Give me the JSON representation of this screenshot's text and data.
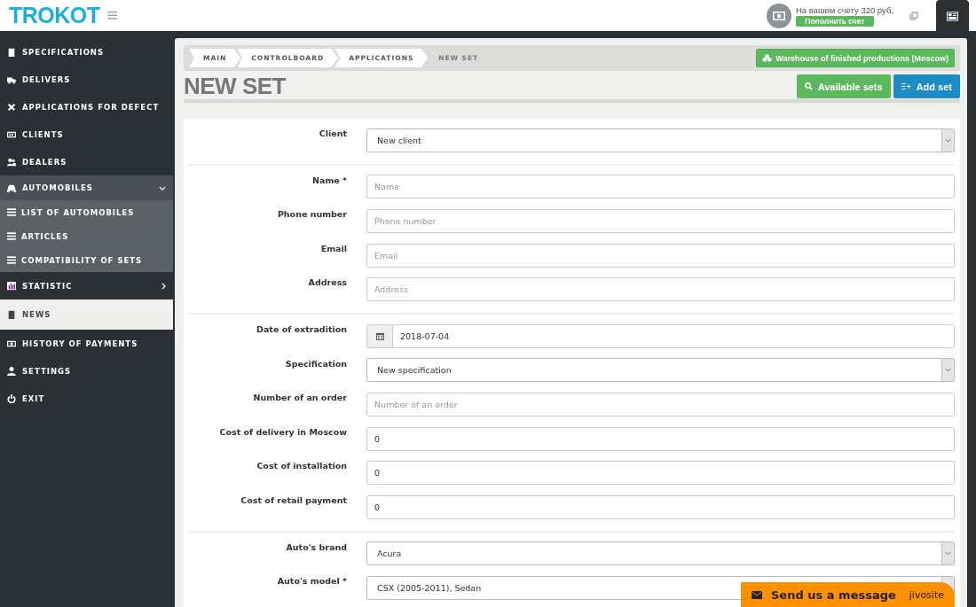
{
  "header": {
    "logo": "TROKOT",
    "balance": "На вашем счету 320 руб.",
    "topup_button": "Пополнить счет"
  },
  "sidebar": {
    "items": [
      {
        "label": "SPECIFICATIONS",
        "selected": false
      },
      {
        "label": "DELIVERS",
        "selected": false
      },
      {
        "label": "APPLICATIONS FOR DEFECT",
        "selected": false
      },
      {
        "label": "CLIENTS",
        "selected": false
      },
      {
        "label": "DEALERS",
        "selected": false
      },
      {
        "label": "AUTOMOBILES",
        "selected": false,
        "expanded": true,
        "children": [
          {
            "label": "LIST OF AUTOMOBILES"
          },
          {
            "label": "ARTICLES"
          },
          {
            "label": "COMPATIBILITY OF SETS"
          }
        ]
      },
      {
        "label": "STATISTIC",
        "selected": false,
        "expanded": false
      },
      {
        "label": "NEWS",
        "selected": true
      },
      {
        "label": "HISTORY OF PAYMENTS",
        "selected": false
      },
      {
        "label": "SETTINGS",
        "selected": false
      },
      {
        "label": "EXIT",
        "selected": false
      }
    ]
  },
  "breadcrumbs": [
    "MAIN",
    "CONTROLBOARD",
    "APPLICATIONS",
    "NEW SET"
  ],
  "warehouse_button": "Warehouse of finished productions (Moscow)",
  "page_title": "NEW SET",
  "actions": [
    {
      "label": "Available sets",
      "kind": "search"
    },
    {
      "label": "Add set",
      "kind": "add"
    }
  ],
  "form": {
    "sections": [
      [
        {
          "label": "Client",
          "kind": "select",
          "value": "New client"
        }
      ],
      [
        {
          "label": "Name *",
          "kind": "text",
          "placeholder": "Name"
        },
        {
          "label": "Phone number",
          "kind": "text",
          "placeholder": "Phone number"
        },
        {
          "label": "Email",
          "kind": "text",
          "placeholder": "Email"
        },
        {
          "label": "Address",
          "kind": "text",
          "placeholder": "Address"
        }
      ],
      [
        {
          "label": "Date of extradition",
          "kind": "date",
          "value": "2018-07-04"
        },
        {
          "label": "Specification",
          "kind": "select",
          "value": "New specification"
        },
        {
          "label": "Number of an order",
          "kind": "text",
          "placeholder": "Number of an order"
        },
        {
          "label": "Cost of delivery in Moscow",
          "kind": "text",
          "value": "0"
        },
        {
          "label": "Cost of installation",
          "kind": "text",
          "value": "0"
        },
        {
          "label": "Cost of retail payment",
          "kind": "text",
          "value": "0"
        }
      ],
      [
        {
          "label": "Auto's brand",
          "kind": "select",
          "value": "Acura"
        },
        {
          "label": "Auto's model *",
          "kind": "select",
          "value": "CSX (2005-2011), Sedan"
        }
      ]
    ]
  },
  "chat": {
    "label": "Send us a message",
    "brand": "jivosite"
  }
}
